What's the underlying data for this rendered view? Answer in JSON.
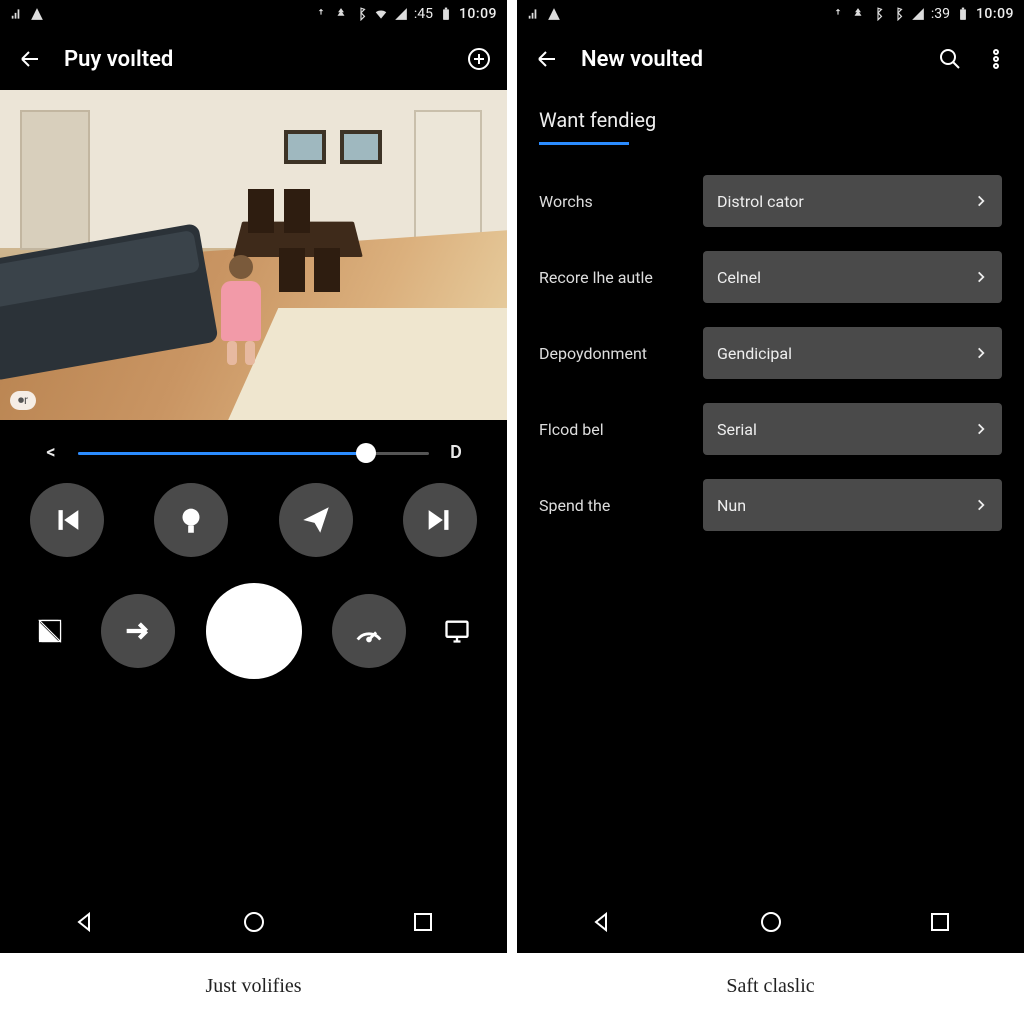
{
  "left": {
    "status": {
      "clock": "10:09",
      "net_label": ":45"
    },
    "appbar": {
      "title": "Puy voılted"
    },
    "camera": {
      "badge": "⏺r"
    },
    "slider": {
      "left_glyph": "<",
      "right_glyph": "D",
      "percent": 82
    },
    "caption": "Just volifies"
  },
  "right": {
    "status": {
      "clock": "10:09",
      "net_label": ":39"
    },
    "appbar": {
      "title": "New voulted"
    },
    "section": "Want fendieg",
    "rows": [
      {
        "label": "Worchs",
        "value": "Distrol cator"
      },
      {
        "label": "Recore lhe autle",
        "value": "Celnel"
      },
      {
        "label": "Depoydonment",
        "value": "Gendicipal"
      },
      {
        "label": "Flcod bel",
        "value": "Serial"
      },
      {
        "label": "Spend the",
        "value": "Nun"
      }
    ],
    "caption": "Saft claslic"
  }
}
